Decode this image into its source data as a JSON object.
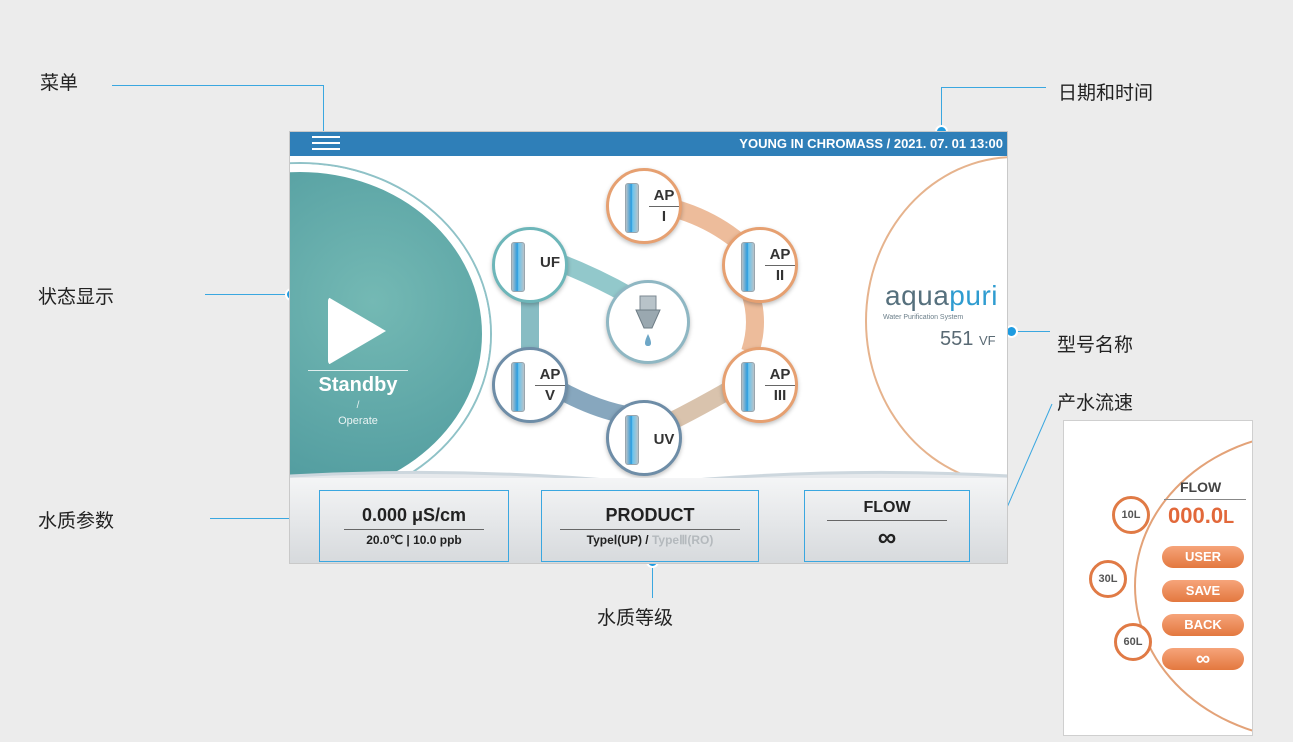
{
  "callouts": {
    "menu": "菜单",
    "datetime": "日期和时间",
    "status": "状态显示",
    "model": "型号名称",
    "flowrate": "产水流速",
    "quality_params": "水质参数",
    "quality_grade": "水质等级"
  },
  "header": {
    "title": "YOUNG IN CHROMASS / 2021. 07. 01 13:00"
  },
  "status": {
    "state": "Standby",
    "separator": "/",
    "alt_state": "Operate"
  },
  "nodes": {
    "ap1": [
      "AP",
      "I"
    ],
    "uf": "UF",
    "ap2": [
      "AP",
      "II"
    ],
    "ap5": [
      "AP",
      "V"
    ],
    "ap3": [
      "AP",
      "III"
    ],
    "uv": "UV"
  },
  "brand": {
    "name_a": "aqua",
    "name_b": "puri",
    "tagline": "Water Purification System",
    "model_num": "551",
    "model_suffix": "VF"
  },
  "bottom": {
    "conductivity": "0.000 μS/cm",
    "temp_ppb": "20.0℃ | 10.0 ppb",
    "product": "PRODUCT",
    "type_active": "TypeⅠ(UP) /",
    "type_inactive": "TypeⅢ(RO)",
    "flow_label": "FLOW",
    "flow_value": "∞"
  },
  "flow_popup": {
    "title": "FLOW",
    "value": "000.0",
    "unit": "L",
    "liters": [
      "10L",
      "30L",
      "60L"
    ],
    "buttons": [
      "USER",
      "SAVE",
      "BACK",
      "∞"
    ]
  },
  "colors": {
    "accent_blue": "#2f7fb8",
    "teal": "#3d8b93",
    "orange": "#e3783f"
  }
}
